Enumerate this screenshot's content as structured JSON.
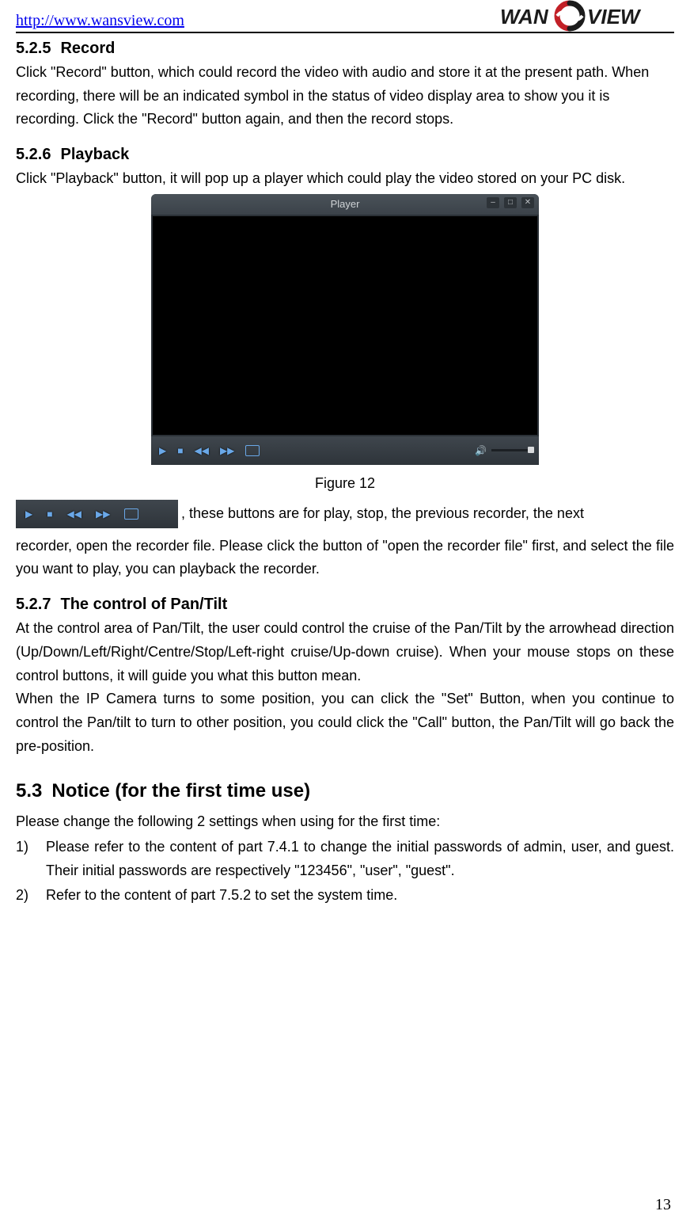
{
  "header": {
    "link_text": "http://www.wansview.com",
    "logo_text": "WANSVIEW"
  },
  "sections": {
    "s525": {
      "num": "5.2.5",
      "title": "Record",
      "body": "Click \"Record\" button, which could record the video with audio and store it at the present path. When recording, there will be an indicated symbol in the status of video display area to show you it is recording. Click the \"Record\" button again, and then the record stops."
    },
    "s526": {
      "num": "5.2.6",
      "title": "Playback",
      "body": "Click \"Playback\" button, it will pop up a player which could play the video stored on your PC disk."
    },
    "player": {
      "title": "Player",
      "figure_caption": "Figure 12",
      "controls_desc_inline": ", these buttons are for play, stop, the previous recorder, the next",
      "controls_desc_cont": "recorder, open the recorder file. Please click the button of \"open the recorder file\" first, and select the file you want to play, you can playback the recorder."
    },
    "s527": {
      "num": "5.2.7",
      "title": "The control of Pan/Tilt",
      "body1": "At the control area of Pan/Tilt, the user could control the cruise of the Pan/Tilt by the arrowhead direction (Up/Down/Left/Right/Centre/Stop/Left-right cruise/Up-down cruise). When your mouse stops on these control buttons, it will guide you what this button mean.",
      "body2": "When the IP Camera turns to some position, you can click the \"Set\" Button, when you continue to control the Pan/tilt to turn to other position, you could click the \"Call\" button, the Pan/Tilt will go back the pre-position."
    },
    "s53": {
      "num": "5.3",
      "title": "Notice (for the first time use)",
      "intro": "Please change the following 2 settings when using for the first time:",
      "items": [
        {
          "num": "1)",
          "text": "Please refer to the content of part 7.4.1 to change the initial passwords of admin, user, and guest. Their initial passwords are respectively \"123456\", \"user\", \"guest\"."
        },
        {
          "num": "2)",
          "text": "Refer to the content of part 7.5.2 to set the system time."
        }
      ]
    }
  },
  "page_number": "13"
}
